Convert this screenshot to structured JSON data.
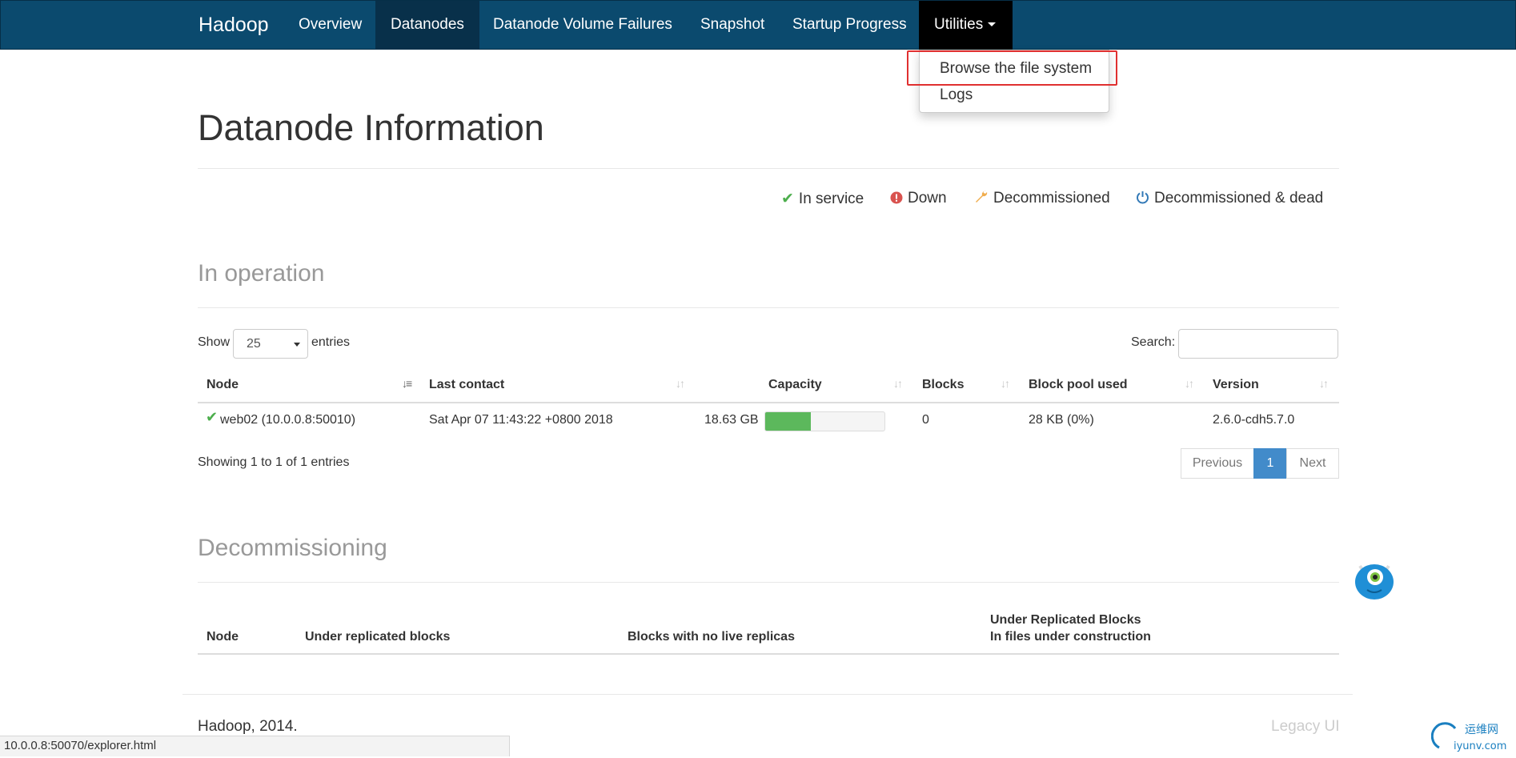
{
  "navbar": {
    "brand": "Hadoop",
    "items": [
      {
        "label": "Overview"
      },
      {
        "label": "Datanodes"
      },
      {
        "label": "Datanode Volume Failures"
      },
      {
        "label": "Snapshot"
      },
      {
        "label": "Startup Progress"
      },
      {
        "label": "Utilities"
      }
    ],
    "active": "Datanodes",
    "open": "Utilities"
  },
  "dropdown": {
    "items": [
      {
        "label": "Browse the file system"
      },
      {
        "label": "Logs"
      }
    ],
    "highlighted": "Browse the file system"
  },
  "page": {
    "title": "Datanode Information"
  },
  "legend": [
    {
      "icon": "check-icon",
      "label": "In service",
      "color": "#4cae4c"
    },
    {
      "icon": "exclamation-circle-icon",
      "label": "Down",
      "color": "#d9534f"
    },
    {
      "icon": "wrench-icon",
      "label": "Decommissioned",
      "color": "#f0ad4e"
    },
    {
      "icon": "power-icon",
      "label": "Decommissioned & dead",
      "color": "#337ab7"
    }
  ],
  "in_operation": {
    "title": "In operation",
    "show_label": "Show",
    "page_size": "25",
    "entries_label": "entries",
    "search_label": "Search:",
    "search_value": "",
    "columns": [
      "Node",
      "Last contact",
      "Capacity",
      "Blocks",
      "Block pool used",
      "Version"
    ],
    "rows": [
      {
        "status_icon": "check-icon",
        "node": "web02 (10.0.0.8:50010)",
        "last_contact": "Sat Apr 07 11:43:22 +0800 2018",
        "capacity": "18.63 GB",
        "capacity_used_fraction": 0.38,
        "blocks": "0",
        "block_pool_used": "28 KB (0%)",
        "version": "2.6.0-cdh5.7.0"
      }
    ],
    "info": "Showing 1 to 1 of 1 entries",
    "pagination": {
      "previous": "Previous",
      "current": "1",
      "next": "Next"
    }
  },
  "decommissioning": {
    "title": "Decommissioning",
    "columns": {
      "node": "Node",
      "under_replicated": "Under replicated blocks",
      "no_live_replicas": "Blocks with no live replicas",
      "under_construction_1": "Under Replicated Blocks",
      "under_construction_2": "In files under construction"
    }
  },
  "footer": {
    "copyright": "Hadoop, 2014.",
    "legacy": "Legacy UI"
  },
  "status_bar": {
    "url": "10.0.0.8:50070/explorer.html"
  },
  "colors": {
    "navbar": "#0b4a6e",
    "navbar_active": "#08304a",
    "progress": "#5cb85c",
    "pager_active": "#428bca",
    "highlight": "#e03030"
  }
}
